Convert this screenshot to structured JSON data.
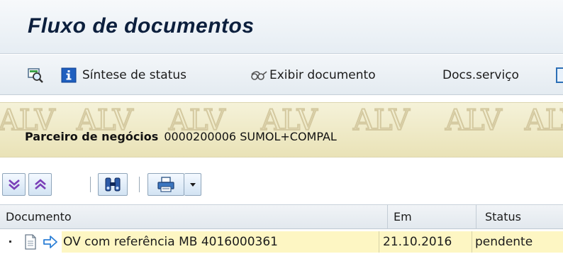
{
  "window": {
    "title": "Fluxo de documentos"
  },
  "toolbar": {
    "status_summary_label": "Síntese de status",
    "display_document_label": "Exibir documento",
    "service_docs_label": "Docs.serviço"
  },
  "header": {
    "partner_label": "Parceiro de negócios",
    "partner_value": "0000200006 SUMOL+COMPAL",
    "watermark_text": "ALV"
  },
  "grid": {
    "columns": [
      {
        "label": "Documento"
      },
      {
        "label": "Em"
      },
      {
        "label": "Status"
      }
    ],
    "rows": [
      {
        "document": "OV com referência MB 4016000361",
        "date": "21.10.2016",
        "status": "pendente"
      }
    ]
  },
  "icons": {
    "toolbar": [
      "find-related-icon",
      "info-icon",
      "display-document-icon"
    ],
    "grid_toolbar": [
      "expand-all-icon",
      "collapse-all-icon",
      "find-icon",
      "print-icon",
      "dropdown-arrow-icon"
    ],
    "row": [
      "tree-bullet-icon",
      "document-icon",
      "arrow-right-icon"
    ]
  },
  "colors": {
    "title": "#0c1f3d",
    "header_background": "#f5f2d9",
    "row_highlight": "#fdf6c3",
    "info_blue": "#1f5fbf",
    "arrow_blue": "#2c7fd6"
  }
}
